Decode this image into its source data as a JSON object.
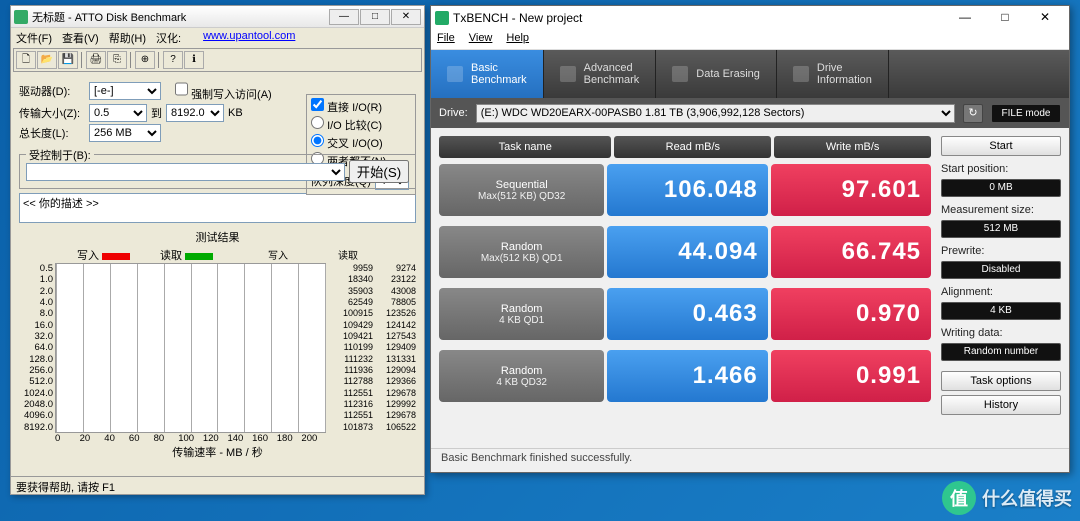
{
  "atto": {
    "title": "无标题 - ATTO Disk Benchmark",
    "menus": {
      "file": "文件(F)",
      "view": "查看(V)",
      "help": "帮助(H)",
      "hanhua": "汉化:",
      "url": "www.upantool.com"
    },
    "labels": {
      "drive": "驱动器(D):",
      "drive_val": "[-e-]",
      "xfer_size": "传输大小(Z):",
      "xfer_from": "0.5",
      "xfer_to": "到",
      "xfer_to_val": "8192.0",
      "xfer_unit": "KB",
      "total_len": "总长度(L):",
      "total_val": "256 MB",
      "force": "强制写入访问(A)",
      "direct": "直接 I/O(R)",
      "io_cmp": "I/O 比较(C)",
      "overlap": "交叉 I/O(O)",
      "neither": "两者都不(N)",
      "qd": "队列深度(Q)",
      "qd_val": "4",
      "controlled": "受控制于(B):",
      "controlled_val": "",
      "start": "开始(S)",
      "desc": "<< 你的描述 >>",
      "results": "测试结果",
      "write": "写入",
      "read": "读取",
      "xaxis": "传输速率 - MB / 秒",
      "status": "要获得帮助, 请按 F1"
    },
    "xticks": [
      "0",
      "20",
      "40",
      "60",
      "80",
      "100",
      "120",
      "140",
      "160",
      "180",
      "200"
    ]
  },
  "tx": {
    "title": "TxBENCH - New project",
    "menus": {
      "file": "File",
      "view": "View",
      "help": "Help"
    },
    "tabs": {
      "basic": "Basic\nBenchmark",
      "adv": "Advanced\nBenchmark",
      "erase": "Data Erasing",
      "info": "Drive\nInformation"
    },
    "drive_label": "Drive:",
    "drive_val": "(E:) WDC WD20EARX-00PASB0  1.81 TB (3,906,992,128 Sectors)",
    "refresh_icon": "↻",
    "filemode": "FILE mode",
    "head": {
      "task": "Task name",
      "read": "Read mB/s",
      "write": "Write mB/s"
    },
    "rows": [
      {
        "name1": "Sequential",
        "name2": "Max(512 KB) QD32",
        "read": "106.048",
        "write": "97.601"
      },
      {
        "name1": "Random",
        "name2": "Max(512 KB) QD1",
        "read": "44.094",
        "write": "66.745"
      },
      {
        "name1": "Random",
        "name2": "4 KB QD1",
        "read": "0.463",
        "write": "0.970"
      },
      {
        "name1": "Random",
        "name2": "4 KB QD32",
        "read": "1.466",
        "write": "0.991"
      }
    ],
    "side": {
      "start": "Start",
      "startpos_lbl": "Start position:",
      "startpos": "0 MB",
      "meas_lbl": "Measurement size:",
      "meas": "512 MB",
      "prewrite_lbl": "Prewrite:",
      "prewrite": "Disabled",
      "align_lbl": "Alignment:",
      "align": "4 KB",
      "wdata_lbl": "Writing data:",
      "wdata": "Random number",
      "taskopt": "Task options",
      "history": "History"
    },
    "status": "Basic Benchmark finished successfully."
  },
  "watermark": {
    "badge": "值",
    "text": "什么值得买"
  },
  "chart_data": {
    "type": "bar",
    "title": "测试结果",
    "xlabel": "传输速率 - MB / 秒",
    "xlim": [
      0,
      200
    ],
    "categories": [
      "0.5",
      "1.0",
      "2.0",
      "4.0",
      "8.0",
      "16.0",
      "32.0",
      "64.0",
      "128.0",
      "256.0",
      "512.0",
      "1024.0",
      "2048.0",
      "4096.0",
      "8192.0"
    ],
    "series": [
      {
        "name": "写入",
        "color": "#e00000",
        "values": [
          9959,
          18340,
          35903,
          62549,
          100915,
          109429,
          109421,
          110199,
          111232,
          111936,
          112788,
          112551,
          112316,
          112551,
          101873
        ]
      },
      {
        "name": "读取",
        "color": "#00a000",
        "values": [
          9274,
          23122,
          43008,
          78805,
          123526,
          124142,
          127543,
          129409,
          131331,
          129094,
          129366,
          129678,
          129992,
          129678,
          106522
        ]
      }
    ],
    "unit": "KB/s (displayed), bars scaled to MB/s on x-axis"
  }
}
